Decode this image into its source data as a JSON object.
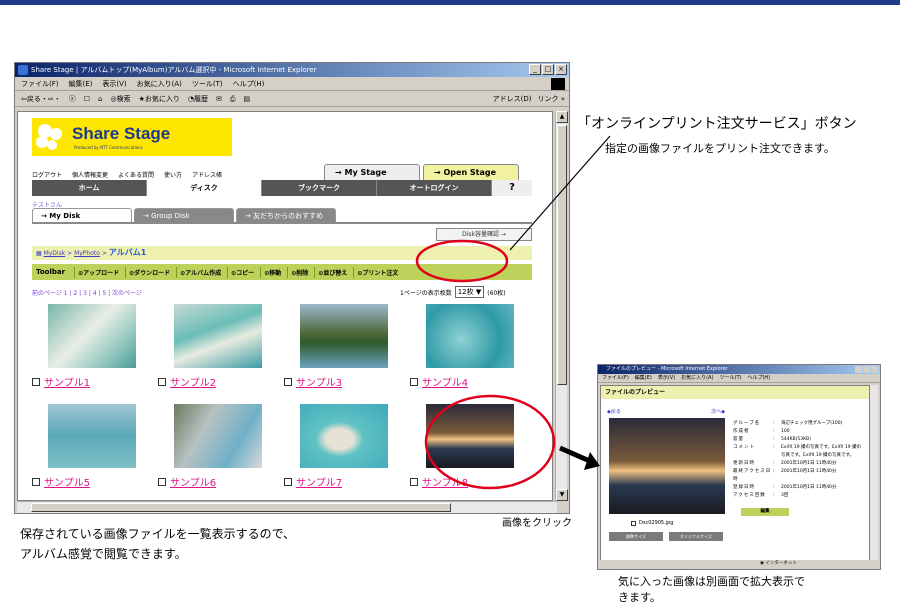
{
  "colors": {
    "top_rule": "#1f3a8a",
    "highlight": "#e0001a",
    "caption_link": "#e0138a",
    "action_bar": "#bcd25a"
  },
  "browser": {
    "title": "Share Stage | アルバムトップ(MyAlbum)アルバム選択中 - Microsoft Internet Explorer",
    "window_buttons": [
      "_",
      "□",
      "×"
    ],
    "menu": [
      "ファイル(F)",
      "編集(E)",
      "表示(V)",
      "お気に入り(A)",
      "ツール(T)",
      "ヘルプ(H)"
    ],
    "toolbar": [
      "⇦戻る・⇨・",
      "ⓧ",
      "☐",
      "⌂",
      "◎検索",
      "★お気に入り",
      "◔履歴",
      "✉",
      "⎙",
      "▤"
    ],
    "address_label": "アドレス(D)",
    "links_label": "リンク »"
  },
  "site": {
    "logo": "Share Stage",
    "logo_sub": "Produced by NTT Communications",
    "top_links": [
      "ログアウト",
      "個人情報変更",
      "よくある質問",
      "使い方",
      "アドレス帳"
    ],
    "stage_tabs": [
      "→ My Stage",
      "→ Open Stage"
    ],
    "nav": [
      "ホーム",
      "ディスク",
      "ブックマーク",
      "オートログイン"
    ],
    "help": "?",
    "user": "テストさん",
    "disk_tabs": [
      "→ My Disk",
      "→ Group Disk",
      "→ 友だちからのおすすめ"
    ],
    "disk_button": "Disk容量確認 →",
    "breadcrumb": {
      "home": "MyDisk",
      "sep": ">",
      "parent": "MyPhoto",
      "current": "アルバム1"
    },
    "action_label": "Toolbar",
    "actions": [
      "アップロード",
      "ダウンロード",
      "アルバム作成",
      "コピー",
      "移動",
      "削除",
      "並び替え",
      "プリント注文"
    ],
    "pager": "前のページ 1 | 2 | 3 | 4 | 5 | 次のページ",
    "per_page_label": "1ページの表示枚数",
    "per_page_value": "12枚",
    "total": "(60枚)",
    "photos": [
      {
        "label": "サンプル1",
        "icon": "sandbar-photo"
      },
      {
        "label": "サンプル2",
        "icon": "lagoon-photo"
      },
      {
        "label": "サンプル3",
        "icon": "island-photo"
      },
      {
        "label": "サンプル4",
        "icon": "reef-photo"
      },
      {
        "label": "サンプル5",
        "icon": "sea-photo"
      },
      {
        "label": "サンプル6",
        "icon": "balcony-photo"
      },
      {
        "label": "サンプル7",
        "icon": "heart-reef-photo"
      },
      {
        "label": "サンプル8",
        "icon": "sunset-photo"
      }
    ]
  },
  "preview": {
    "title": "ファイルのプレビュー - Microsoft Internet Explorer",
    "menu": [
      "ファイル(F)",
      "編集(E)",
      "表示(V)",
      "お気に入り(A)",
      "ツール(T)",
      "ヘルプ(H)"
    ],
    "heading": "ファイルのプレビュー",
    "prev": "◆戻る",
    "next": "次へ◆",
    "filename": "Dsc02905.jpg",
    "buttons": [
      "標準サイズ",
      "オリジナルサイズ"
    ],
    "info": [
      {
        "key": "グループ名",
        "value": "海辺チェック用グループ(100)"
      },
      {
        "key": "作成者",
        "value": "100"
      },
      {
        "key": "容量",
        "value": "544KB(53KB)"
      },
      {
        "key": "コメント",
        "value": "ExifX 19 撮の写真です。ExifX 19 撮の写真です。ExifX 19 撮の写真です。"
      },
      {
        "key": "更新日時",
        "value": "2001年10月1日 11時40分"
      },
      {
        "key": "最終アクセス日時",
        "value": "2001年10月1日 11時40分"
      },
      {
        "key": "登録日時",
        "value": "2001年10月1日 11時40分"
      },
      {
        "key": "アクセス回数",
        "value": "3回"
      }
    ],
    "edit": "編集",
    "status": "インターネット"
  },
  "annotations": {
    "print_button_title": "「オンラインプリント注文サービス」ボタン",
    "print_button_desc": "指定の画像ファイルをプリント注文できます。",
    "click_label": "画像をクリック",
    "caption_line1": "保存されている画像ファイルを一覧表示するので、",
    "caption_line2": "アルバム感覚で閲覧できます。",
    "preview_line1": "気に入った画像は別画面で拡大表示で",
    "preview_line2": "きます。"
  }
}
